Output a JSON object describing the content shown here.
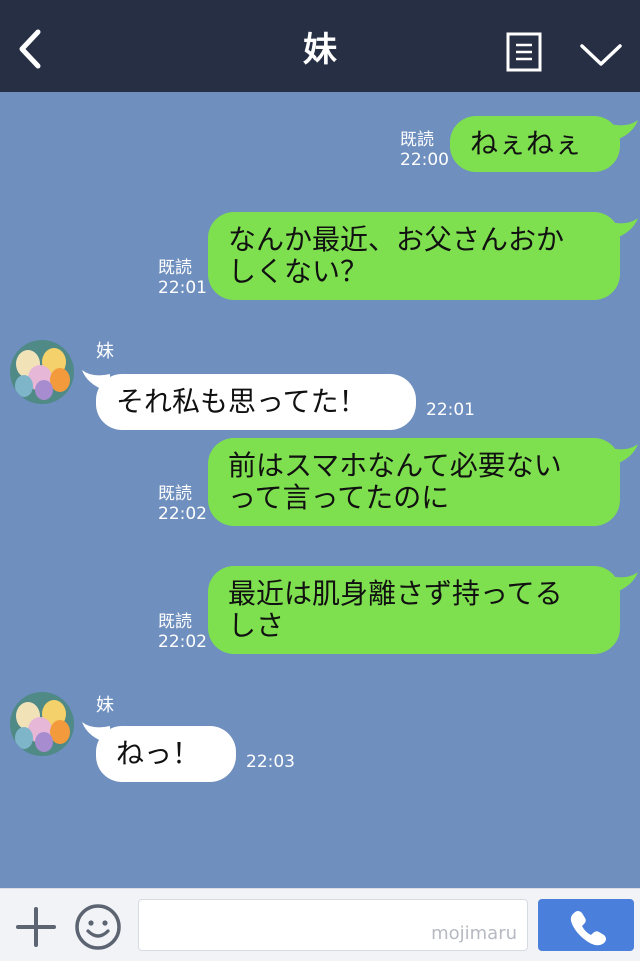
{
  "header": {
    "title": "妹",
    "back_icon": "chevron-left-icon",
    "menu_icon": "menu-icon",
    "dropdown_icon": "chevron-down-icon",
    "bg": "#262f44"
  },
  "chat": {
    "bg": "#6f8fbf",
    "messages": [
      {
        "dir": "sent",
        "text": "ねぇねぇ",
        "read": "既読",
        "time": "22:00"
      },
      {
        "dir": "sent",
        "text": "なんか最近、お父さんおか\nしくない？",
        "read": "既読",
        "time": "22:01"
      },
      {
        "dir": "recv",
        "sender": "妹",
        "text": "それ私も思ってた！",
        "time": "22:01"
      },
      {
        "dir": "sent",
        "text": "前はスマホなんて必要ない\nって言ってたのに",
        "read": "既読",
        "time": "22:02"
      },
      {
        "dir": "sent",
        "text": "最近は肌身離さず持ってる\nしさ",
        "read": "既読",
        "time": "22:02"
      },
      {
        "dir": "recv",
        "sender": "妹",
        "text": "ねっ！",
        "time": "22:03"
      }
    ]
  },
  "composer": {
    "plus_icon": "plus-icon",
    "emoji_icon": "smiley-icon",
    "input_value": "",
    "watermark": "mojimaru",
    "call_icon": "phone-icon",
    "accent": "#4b7fdc"
  }
}
